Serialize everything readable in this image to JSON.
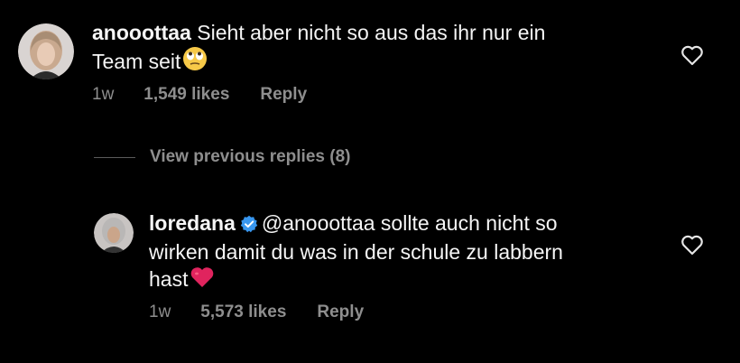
{
  "comment": {
    "username": "anooottaa",
    "text_line1": "Sieht aber nicht so aus das ihr nur ein",
    "text_line2": "Team seit",
    "emoji": "eye-roll-emoji",
    "time": "1w",
    "likes": "1,549 likes",
    "reply_label": "Reply"
  },
  "view_previous": "View previous replies (8)",
  "reply": {
    "username": "loredana",
    "verified": true,
    "mention": "@anooottaa",
    "text_line1": " sollte auch nicht so",
    "text_line2": "wirken damit du was in der schule zu labbern",
    "text_line3": "hast",
    "emoji": "red-heart-emoji",
    "time": "1w",
    "likes": "5,573 likes",
    "reply_label": "Reply"
  },
  "colors": {
    "background": "#000000",
    "text": "#f5f5f5",
    "secondary": "#8e8e8e",
    "verified_blue": "#3897f0",
    "heart_red": "#e0245e"
  }
}
